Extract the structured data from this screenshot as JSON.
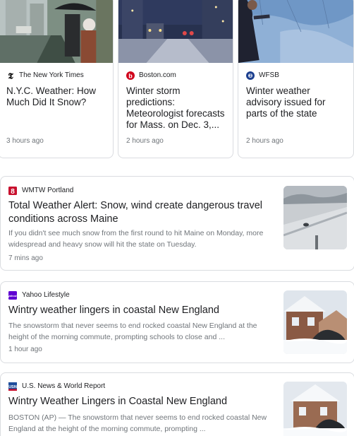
{
  "top_stories": [
    {
      "source": "The New York Times",
      "title": "N.Y.C. Weather: How Much Did It Snow?",
      "time": "3 hours ago",
      "icon": "nyt-logo-icon"
    },
    {
      "source": "Boston.com",
      "title": "Winter storm predictions: Meteorologist forecasts for Mass. on Dec. 3,...",
      "time": "2 hours ago",
      "icon": "boston-com-logo-icon"
    },
    {
      "source": "WFSB",
      "title": "Winter weather advisory issued for parts of the state",
      "time": "2 hours ago",
      "icon": "wfsb-logo-icon"
    }
  ],
  "articles": [
    {
      "source": "WMTW Portland",
      "title": "Total Weather Alert: Snow, wind create dangerous travel conditions across Maine",
      "snippet": "If you didn't see much snow from the first round to hit Maine on Monday, more widespread and heavy snow will hit the state on Tuesday.",
      "time": "7 mins ago"
    },
    {
      "source": "Yahoo Lifestyle",
      "title": "Wintry weather lingers in coastal New England",
      "snippet": "The snowstorm that never seems to end rocked coastal New England at the height of the morning commute, prompting schools to close and ...",
      "time": "1 hour ago"
    },
    {
      "source": "U.S. News & World Report",
      "title": "Wintry Weather Lingers in Coastal New England",
      "snippet": "BOSTON (AP) — The snowstorm that never seems to end rocked coastal New England at the height of the morning commute, prompting ...",
      "time": ""
    }
  ],
  "colors": {
    "border": "#dadce0",
    "title": "#202124",
    "meta": "#70757a",
    "boston_red": "#d0021b",
    "yahoo_purple": "#6001d2",
    "wmtw_red": "#c8102e",
    "usnews_blue": "#1f4e9c"
  }
}
